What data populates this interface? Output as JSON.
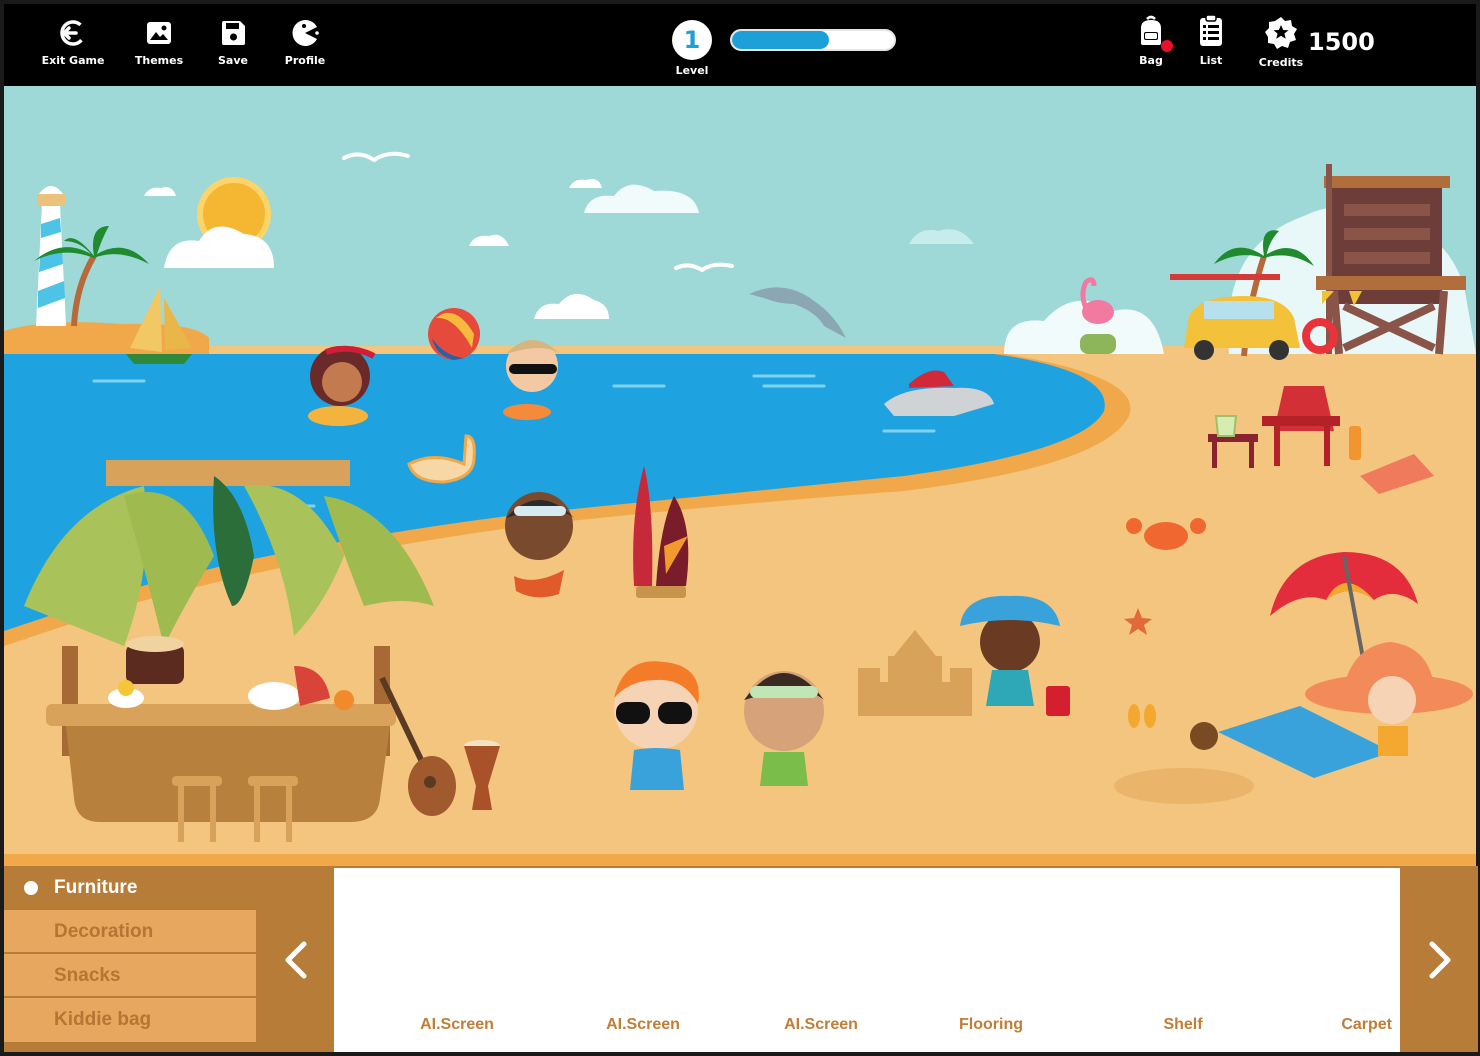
{
  "toolbar": {
    "exit": {
      "label": "Exit Game",
      "icon": "exit-icon"
    },
    "themes": {
      "label": "Themes",
      "icon": "image-icon"
    },
    "save": {
      "label": "Save",
      "icon": "save-icon"
    },
    "profile": {
      "label": "Profile",
      "icon": "pacman-icon"
    }
  },
  "level": {
    "value": "1",
    "label": "Level",
    "progress": 0.6
  },
  "right_toolbar": {
    "bag": {
      "label": "Bag",
      "icon": "backpack-icon",
      "has_notification": true
    },
    "list": {
      "label": "List",
      "icon": "clipboard-icon"
    },
    "credits": {
      "label": "Credits",
      "icon": "star-badge-icon",
      "value": "1500"
    }
  },
  "categories": [
    {
      "label": "Furniture",
      "active": true
    },
    {
      "label": "Decoration",
      "active": false
    },
    {
      "label": "Snacks",
      "active": false
    },
    {
      "label": "Kiddie bag",
      "active": false
    }
  ],
  "items": [
    {
      "label": "AI.Screen"
    },
    {
      "label": "AI.Screen"
    },
    {
      "label": "AI.Screen"
    },
    {
      "label": "Flooring"
    },
    {
      "label": "Shelf"
    },
    {
      "label": "Carpet"
    }
  ],
  "colors": {
    "accent": "#1d9fd8",
    "panel_brown": "#b87c39",
    "panel_tan": "#e8a75e",
    "sky": "#9ed9d8",
    "sea": "#1fa3e0",
    "sand": "#f4c57e"
  }
}
